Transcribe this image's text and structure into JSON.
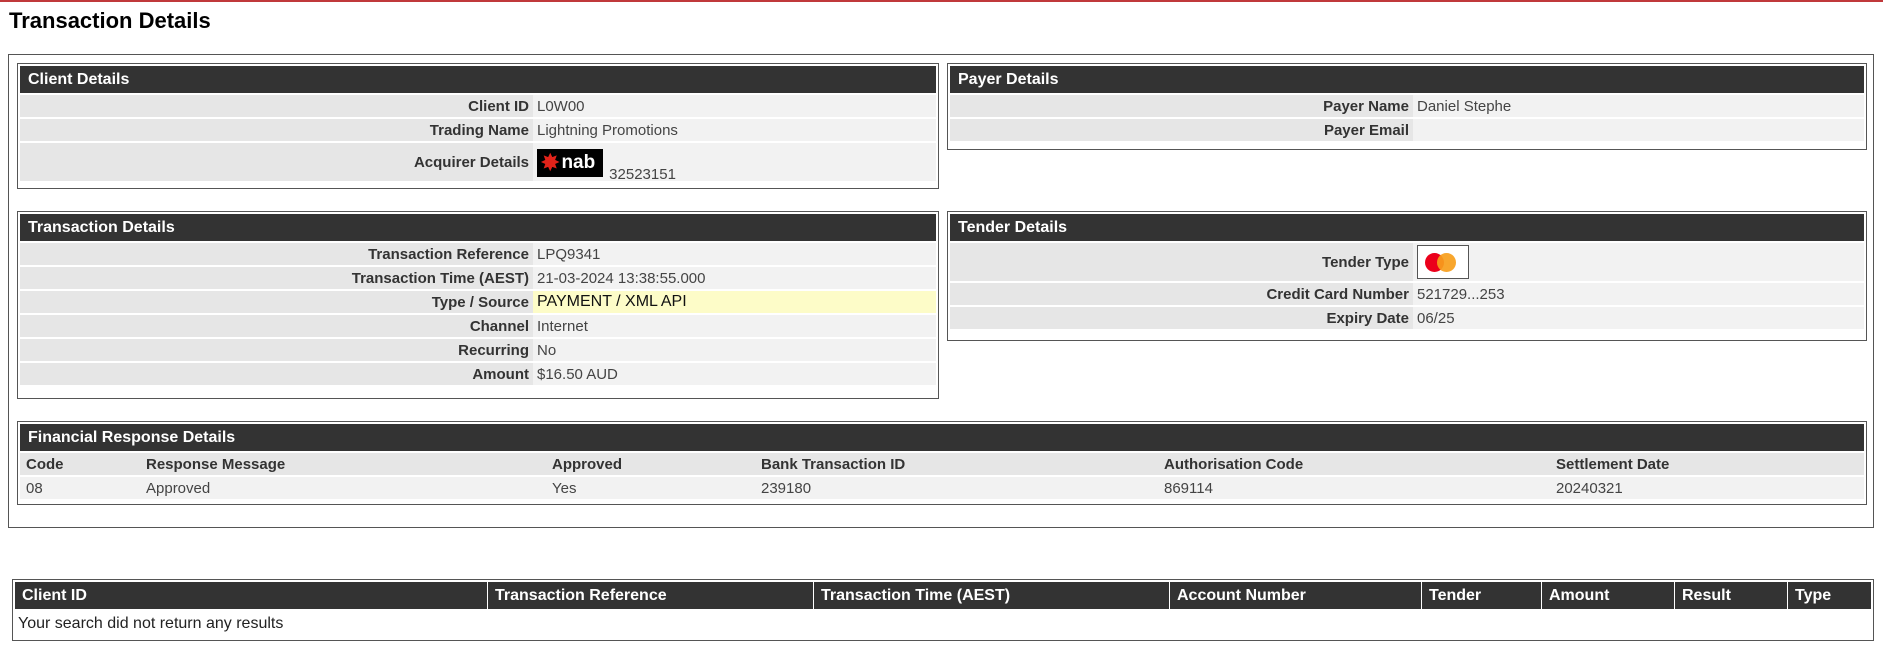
{
  "page": {
    "title": "Transaction Details"
  },
  "client_details": {
    "header": "Client Details",
    "rows": [
      {
        "label": "Client ID",
        "value": "L0W00"
      },
      {
        "label": "Trading Name",
        "value": "Lightning Promotions"
      }
    ],
    "acquirer": {
      "label": "Acquirer Details",
      "logo_text": "nab",
      "logo_icon": "nab-star-icon",
      "number": "32523151"
    }
  },
  "payer_details": {
    "header": "Payer Details",
    "rows": [
      {
        "label": "Payer Name",
        "value": "Daniel Stephe"
      },
      {
        "label": "Payer Email",
        "value": ""
      }
    ]
  },
  "transaction_details": {
    "header": "Transaction Details",
    "rows": [
      {
        "label": "Transaction Reference",
        "value": "LPQ9341"
      },
      {
        "label": "Transaction Time (AEST)",
        "value": "21-03-2024 13:38:55.000"
      },
      {
        "label": "Type / Source",
        "value": "PAYMENT / XML API"
      },
      {
        "label": "Channel",
        "value": "Internet"
      },
      {
        "label": "Recurring",
        "value": "No"
      },
      {
        "label": "Amount",
        "value": "$16.50 AUD"
      }
    ],
    "highlight_color": "#fdfcc8"
  },
  "tender_details": {
    "header": "Tender Details",
    "tender_type": {
      "label": "Tender Type",
      "icon": "mastercard-icon"
    },
    "rows": [
      {
        "label": "Credit Card Number",
        "value": "521729...253"
      },
      {
        "label": "Expiry Date",
        "value": "06/25"
      }
    ]
  },
  "financial_response": {
    "header": "Financial Response Details",
    "columns": [
      "Code",
      "Response Message",
      "Approved",
      "Bank Transaction ID",
      "Authorisation Code",
      "Settlement Date"
    ],
    "row": [
      "08",
      "Approved",
      "Yes",
      "239180",
      "869114",
      "20240321"
    ]
  },
  "results_table": {
    "columns": [
      "Client ID",
      "Transaction Reference",
      "Transaction Time (AEST)",
      "Account Number",
      "Tender",
      "Amount",
      "Result",
      "Type"
    ],
    "empty_message": "Your search did not return any results"
  },
  "colors": {
    "header_bg": "#333333",
    "accent_line": "#c0393b",
    "label_bg": "#e6e6e6",
    "value_bg": "#f2f2f2"
  }
}
